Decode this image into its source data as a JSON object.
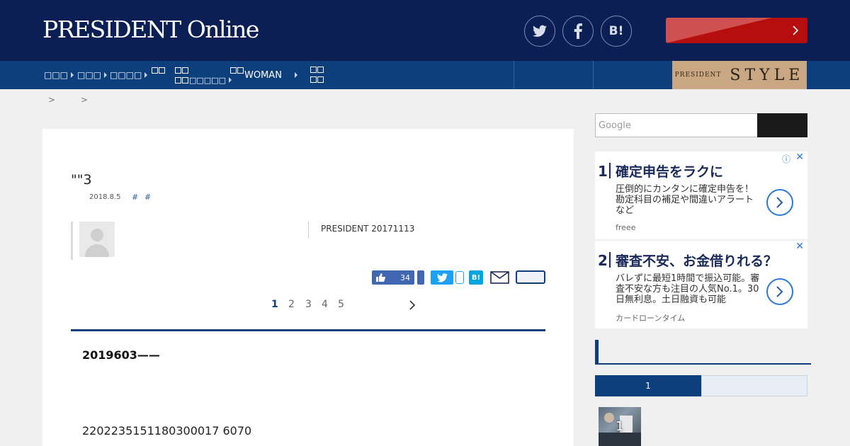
{
  "header": {
    "logo": "PRESIDENT Online",
    "social": {
      "twitter_icon": "twitter-icon",
      "facebook_icon": "facebook-icon",
      "hatena_label": "B!"
    }
  },
  "nav": {
    "items": [
      {
        "label": "□□□"
      },
      {
        "label": "□□□"
      },
      {
        "label": "□□□□"
      },
      {
        "label": ""
      },
      {
        "label": "□□□□□"
      },
      {
        "label": "WOMAN"
      },
      {
        "label": ""
      }
    ],
    "style_banner": {
      "small": "PRESIDENT",
      "big": "STYLE"
    }
  },
  "breadcrumb": [
    ">",
    ">"
  ],
  "article": {
    "title": "\"\"3",
    "date": "2018.8.5",
    "tags": [
      "#",
      "#"
    ],
    "source": "PRESIDENT 20171113",
    "like_count": "34",
    "pages": [
      "1",
      "2",
      "3",
      "4",
      "5"
    ],
    "current_page": "1",
    "lead": "2019603——",
    "body": "2202235151180300017 6070"
  },
  "sidebar": {
    "search_placeholder": "Google",
    "ads": [
      {
        "num": "1",
        "title": "確定申告をラクに",
        "desc": "圧倒的にカンタンに確定申告を！勘定科目の補足や間違いアラートなど",
        "source": "freee"
      },
      {
        "num": "2",
        "title": "審査不安、お金借りれる？",
        "desc": "バレずに最短1時間で振込可能。審査不安な方も注目の人気No.1。30日無利息。土日融資も可能",
        "source": "カードローンタイム"
      }
    ],
    "ranking": {
      "active_tab": "1",
      "first_rank": "1"
    }
  },
  "colors": {
    "header_bg": "#0b1f55",
    "nav_bg": "#0d3f7d",
    "accent_red": "#b60e0e",
    "style_gold": "#c9a782"
  }
}
